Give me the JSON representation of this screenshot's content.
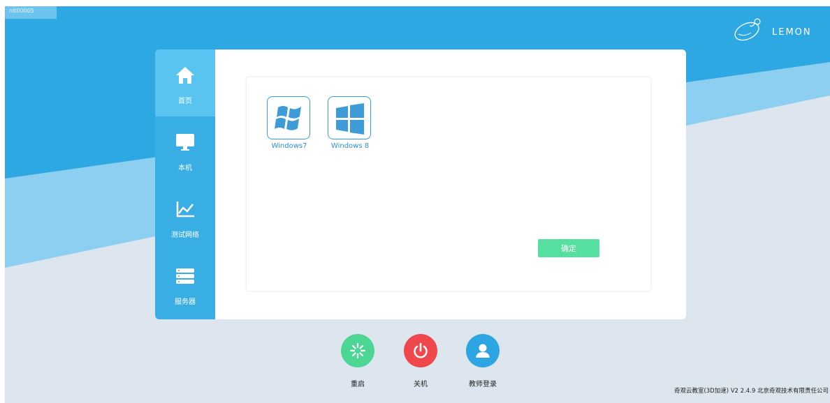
{
  "machine_id": "nlt00005",
  "brand": {
    "name": "LEMON"
  },
  "sidebar": {
    "items": [
      {
        "label": "首页",
        "icon": "home-icon",
        "active": true
      },
      {
        "label": "本机",
        "icon": "monitor-icon",
        "active": false
      },
      {
        "label": "测试网络",
        "icon": "line-chart-icon",
        "active": false
      },
      {
        "label": "服务器",
        "icon": "server-icon",
        "active": false
      }
    ]
  },
  "systems": [
    {
      "name": "Windows7",
      "icon": "windows7-logo-icon"
    },
    {
      "name": "Windows 8",
      "icon": "windows8-logo-icon"
    }
  ],
  "confirm_label": "确定",
  "actions": [
    {
      "label": "重启",
      "icon": "restart-spinner-icon",
      "color": "#4cd694"
    },
    {
      "label": "关机",
      "icon": "power-icon",
      "color": "#f0474d"
    },
    {
      "label": "教师登录",
      "icon": "user-icon",
      "color": "#2ea5e3"
    }
  ],
  "footer": {
    "text": "奇观云教室(3D加速) V2  2.4.9 北京奇观技术有限责任公司"
  },
  "colors": {
    "sky_blue": "#2ea8e2",
    "light_blue": "#8ccff0",
    "bottom_bg": "#dde6ee",
    "sidebar": "#38aee4",
    "sidebar_active": "#5ac4f1",
    "confirm": "#56e0a0"
  }
}
